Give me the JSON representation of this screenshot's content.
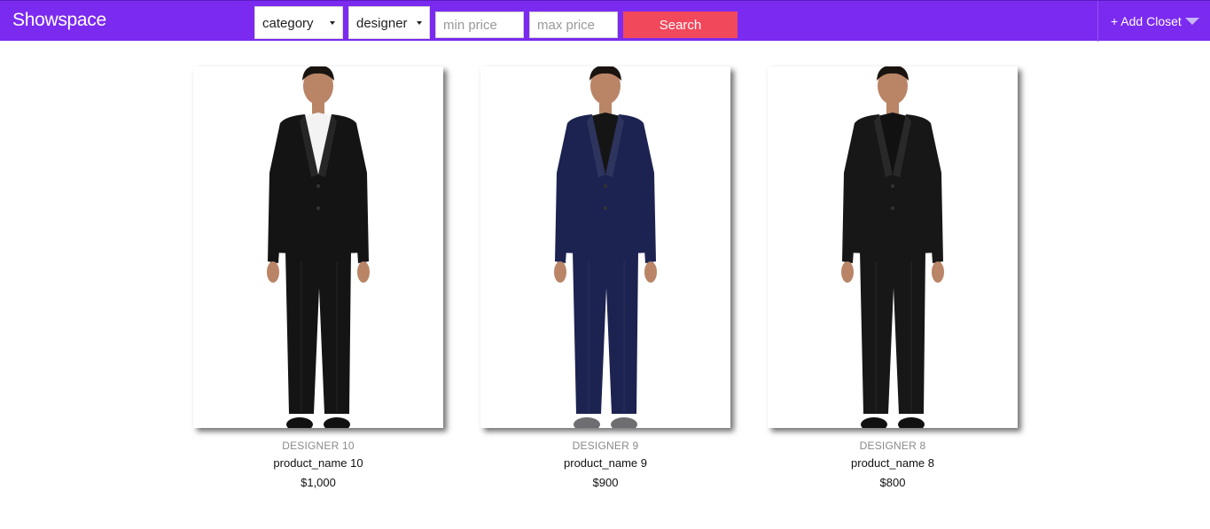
{
  "brand": "Showspace",
  "filters": {
    "category": "category",
    "designer": "designer",
    "min_price_placeholder": "min price",
    "max_price_placeholder": "max price",
    "search_label": "Search"
  },
  "nav": {
    "add_closet": "+ Add Closet"
  },
  "colors": {
    "navbar": "#7b2af0",
    "search_button": "#f2485c"
  },
  "products": [
    {
      "designer": "DESIGNER 10",
      "name": "product_name 10",
      "price": "$1,000",
      "suit_color": "#141414",
      "shirt_color": "#f3f3f3",
      "shoe_color": "#111111"
    },
    {
      "designer": "DESIGNER 9",
      "name": "product_name 9",
      "price": "$900",
      "suit_color": "#1c2350",
      "shirt_color": "#151515",
      "shoe_color": "#6d6d72"
    },
    {
      "designer": "DESIGNER 8",
      "name": "product_name 8",
      "price": "$800",
      "suit_color": "#171717",
      "shirt_color": "#111111",
      "shoe_color": "#111111"
    }
  ]
}
